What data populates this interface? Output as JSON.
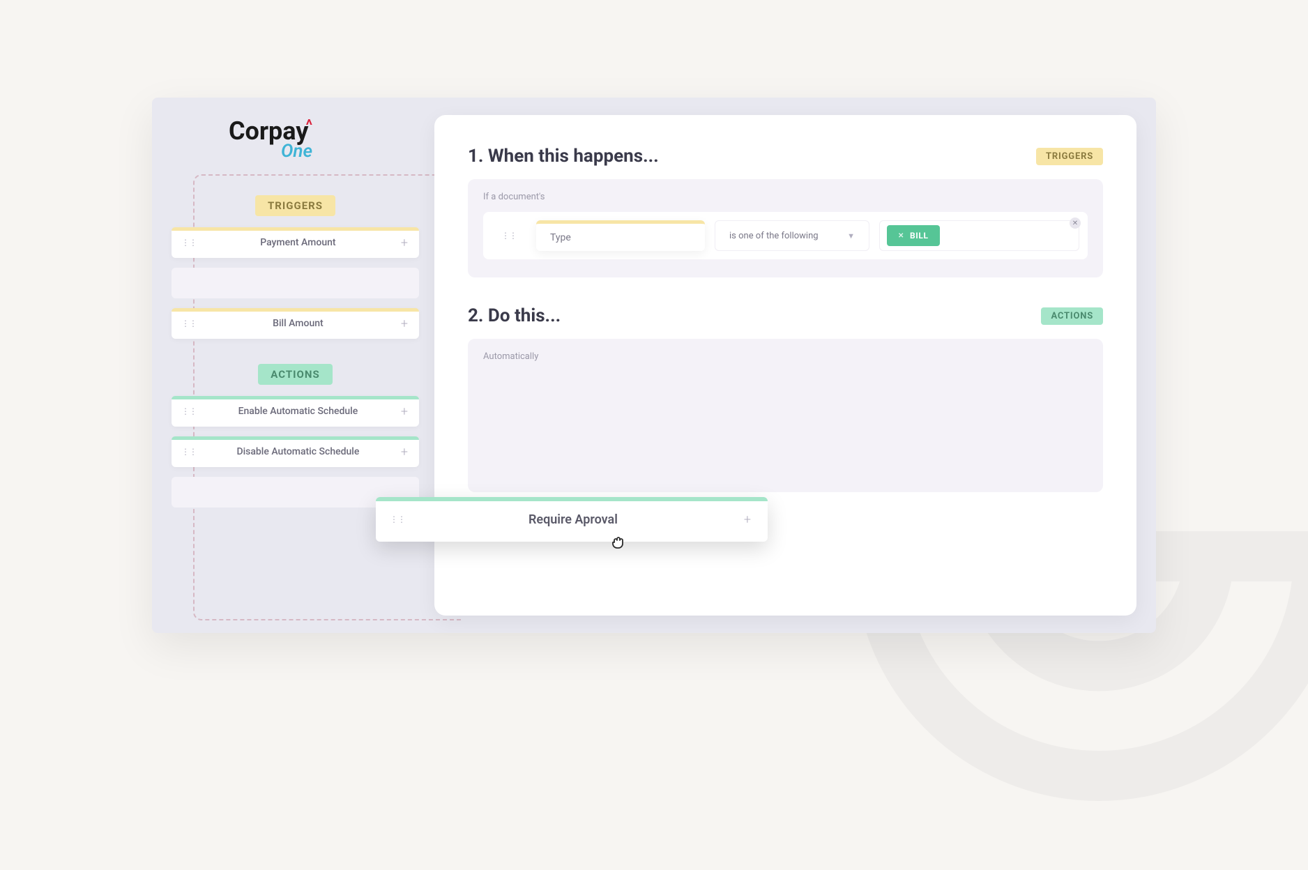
{
  "brand": {
    "name": "Corpay",
    "sub": "One"
  },
  "sidebar": {
    "triggers_label": "TRIGGERS",
    "actions_label": "ACTIONS",
    "triggers": [
      {
        "label": "Payment Amount"
      },
      {
        "label": "Bill Amount"
      }
    ],
    "actions": [
      {
        "label": "Enable Automatic Schedule"
      },
      {
        "label": "Disable Automatic Schedule"
      }
    ]
  },
  "step1": {
    "title": "1. When this happens...",
    "badge": "TRIGGERS",
    "hint": "If a document's",
    "field": "Type",
    "operator": "is one of the following",
    "value": "BILL"
  },
  "step2": {
    "title": "2. Do this...",
    "badge": "ACTIONS",
    "hint": "Automatically"
  },
  "dragging": {
    "label": "Require Aproval"
  }
}
